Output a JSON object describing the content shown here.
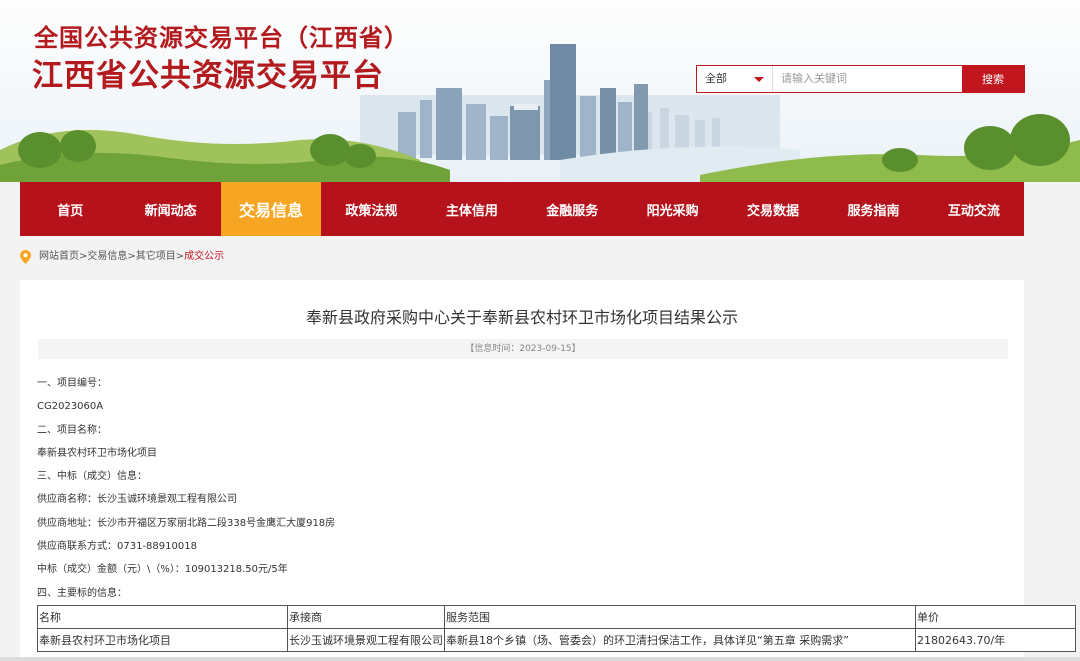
{
  "header": {
    "title_line1": "全国公共资源交易平台（江西省）",
    "title_line2": "江西省公共资源交易平台",
    "search": {
      "scope": "全部",
      "placeholder": "请输入关键词",
      "button": "搜索"
    }
  },
  "nav": {
    "items": [
      "首页",
      "新闻动态",
      "交易信息",
      "政策法规",
      "主体信用",
      "金融服务",
      "阳光采购",
      "交易数据",
      "服务指南",
      "互动交流"
    ],
    "active_index": 2
  },
  "breadcrumb": {
    "items": [
      "网站首页",
      "交易信息",
      "其它项目"
    ],
    "separator": ">",
    "current": "成交公示"
  },
  "article": {
    "title": "奉新县政府采购中心关于奉新县农村环卫市场化项目结果公示",
    "meta": "【信息时间：2023-09-15】",
    "lines": [
      "一、项目编号：",
      "CG2023060A",
      "二、项目名称：",
      "奉新县农村环卫市场化项目",
      "三、中标（成交）信息：",
      "供应商名称：长沙玉诚环境景观工程有限公司",
      "供应商地址：长沙市开福区万家丽北路二段338号金鹰汇大厦918房",
      "供应商联系方式：0731-88910018",
      "中标（成交）金额（元）\\（%）：109013218.50元/5年",
      "四、主要标的信息："
    ],
    "table": {
      "headers": [
        "名称",
        "承接商",
        "服务范围",
        "单价"
      ],
      "rows": [
        [
          "奉新县农村环卫市场化项目",
          "长沙玉诚环境景观工程有限公司",
          "奉新县18个乡镇（场、管委会）的环卫清扫保洁工作，具体详见“第五章 采购需求”",
          "21802643.70/年"
        ]
      ]
    }
  },
  "colors": {
    "brand_red": "#b5121b",
    "active_orange": "#f6a623",
    "title_red": "#b21a1e"
  },
  "icons": [
    "search-icon",
    "location-pin-icon",
    "chevron-down-icon"
  ]
}
